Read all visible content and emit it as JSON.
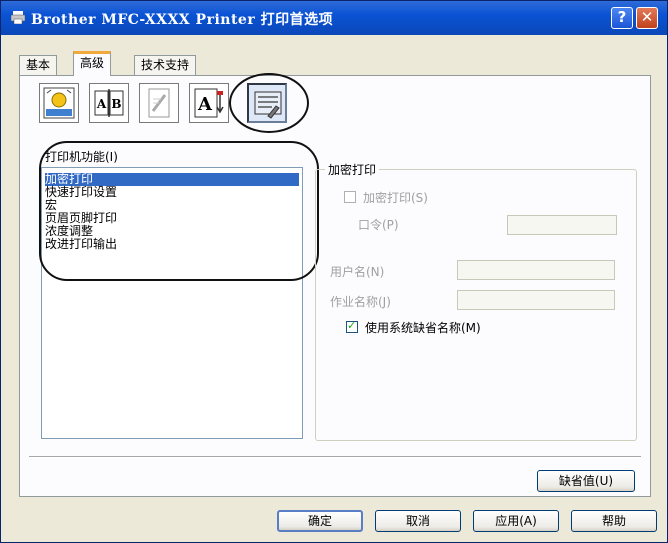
{
  "window": {
    "title": "Brother  MFC-XXXX  Printer 打印首选项",
    "help_label": "?",
    "close_label": "✕"
  },
  "tabs": [
    {
      "label": "基本",
      "active": false
    },
    {
      "label": "高级",
      "active": true
    },
    {
      "label": "技术支持",
      "active": false
    }
  ],
  "toolbar": {
    "icons": [
      "image-quality-icon",
      "duplex-icon",
      "watermark-icon",
      "page-setting-icon",
      "device-options-icon"
    ],
    "selected_index": 4,
    "duplex_text": "A|B",
    "page_text": "A"
  },
  "functions": {
    "label": "打印机功能(I)",
    "items": [
      "加密打印",
      "快速打印设置",
      "宏",
      "页眉页脚打印",
      "浓度调整",
      "改进打印输出"
    ],
    "selected": "加密打印"
  },
  "secure_print": {
    "group_title": "加密打印",
    "checkbox_label": "加密打印(S)",
    "checkbox_checked": false,
    "password_label": "口令(P)",
    "password_value": "",
    "username_label": "用户名(N)",
    "username_value": "",
    "jobname_label": "作业名称(J)",
    "jobname_value": "",
    "use_default_label": "使用系统缺省名称(M)",
    "use_default_checked": true
  },
  "buttons": {
    "default": "缺省值(U)",
    "ok": "确定",
    "cancel": "取消",
    "apply": "应用(A)",
    "help": "帮助"
  },
  "colors": {
    "titlebar": "#0a53d4",
    "selection": "#316ac5",
    "dialog_bg": "#ece9d8"
  }
}
